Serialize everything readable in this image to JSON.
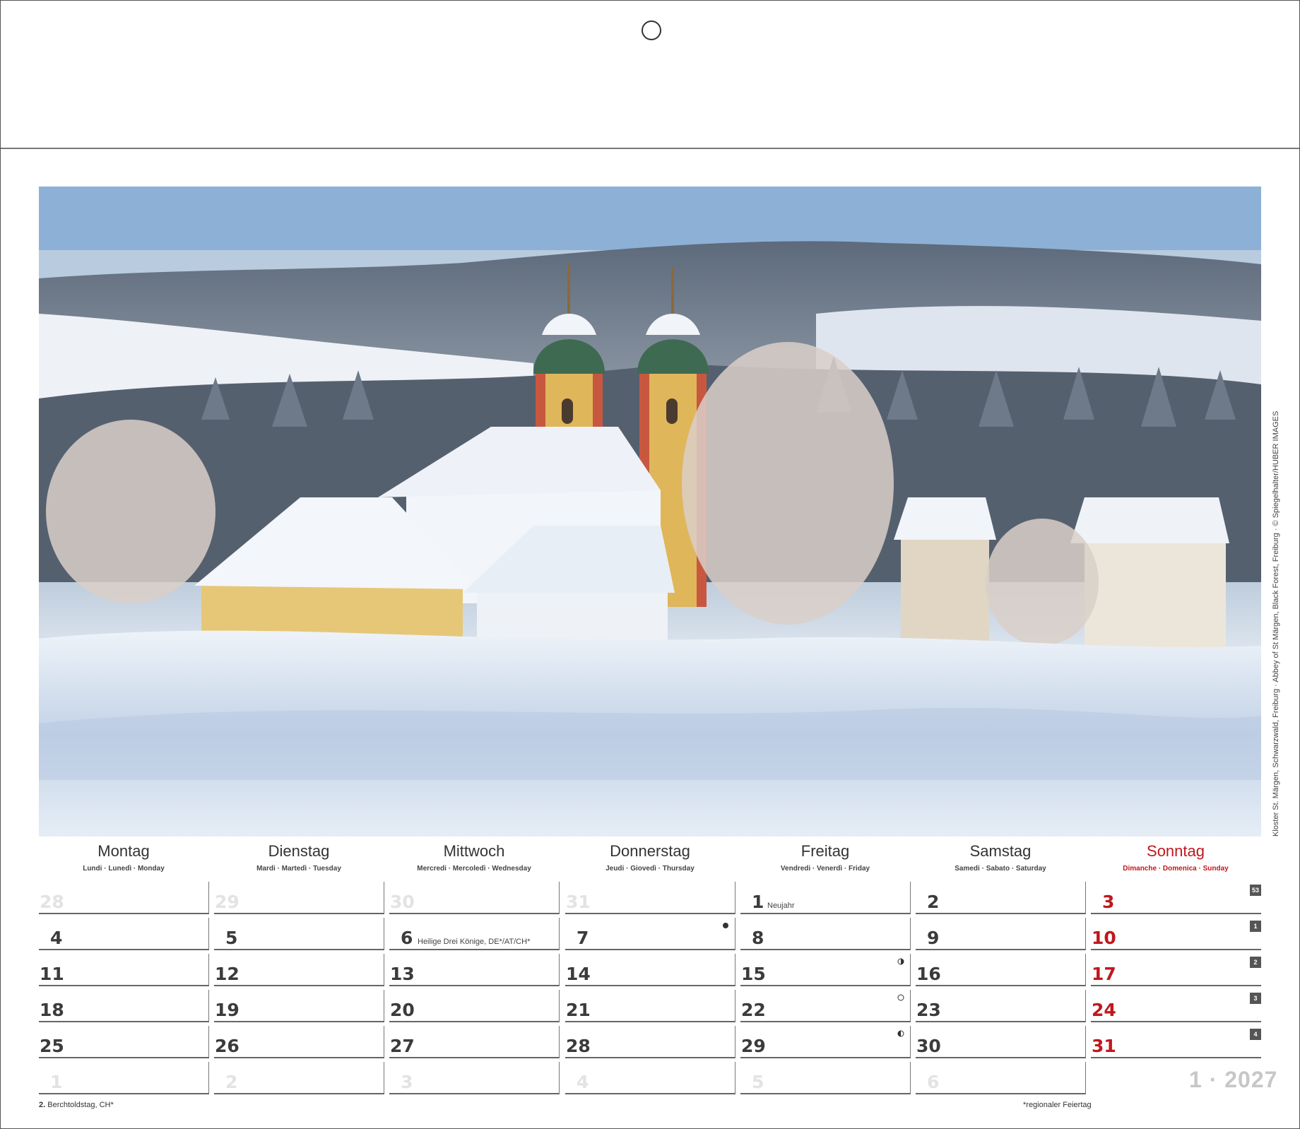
{
  "photo": {
    "caption": "Kloster St. Märgen, Schwarzwald, Freiburg · Abbey of St Märgen, Black Forest, Freiburg · © Spiegelhalter/HUBER IMAGES"
  },
  "weekdays": [
    {
      "name": "Montag",
      "sub": "Lundi · Lunedì · Monday"
    },
    {
      "name": "Dienstag",
      "sub": "Mardi · Martedì · Tuesday"
    },
    {
      "name": "Mittwoch",
      "sub": "Mercredi · Mercoledì · Wednesday"
    },
    {
      "name": "Donnerstag",
      "sub": "Jeudi · Giovedì · Thursday"
    },
    {
      "name": "Freitag",
      "sub": "Vendredi · Venerdì · Friday"
    },
    {
      "name": "Samstag",
      "sub": "Samedi · Sabato · Saturday"
    },
    {
      "name": "Sonntag",
      "sub": "Dimanche · Domenica · Sunday"
    }
  ],
  "weeks": [
    {
      "days": [
        "28",
        "29",
        "30",
        "31",
        "1",
        "2",
        "3"
      ],
      "week_no": "53"
    },
    {
      "days": [
        "4",
        "5",
        "6",
        "7",
        "8",
        "9",
        "10"
      ],
      "week_no": "1"
    },
    {
      "days": [
        "11",
        "12",
        "13",
        "14",
        "15",
        "16",
        "17"
      ],
      "week_no": "2"
    },
    {
      "days": [
        "18",
        "19",
        "20",
        "21",
        "22",
        "23",
        "24"
      ],
      "week_no": "3"
    },
    {
      "days": [
        "25",
        "26",
        "27",
        "28",
        "29",
        "30",
        "31"
      ],
      "week_no": "4"
    },
    {
      "days": [
        "1",
        "2",
        "3",
        "4",
        "5",
        "6"
      ]
    }
  ],
  "notes": {
    "neujahr": "Neujahr",
    "drei_koenige": "Heilige Drei Könige, DE*/AT/CH*"
  },
  "moon_phases": {
    "thursday_7": "new-moon-icon",
    "friday_15": "first-quarter-icon",
    "friday_22": "full-moon-icon",
    "friday_29": "last-quarter-icon"
  },
  "month_year": "1 · 2027",
  "footer": {
    "left_bold": "2.",
    "left_text": " Berchtoldstag, CH*",
    "right_text": "*regionaler Feiertag"
  },
  "colors": {
    "sunday_red": "#c0181e",
    "text": "#3b3b3b",
    "faded": "#e3e3e3"
  }
}
